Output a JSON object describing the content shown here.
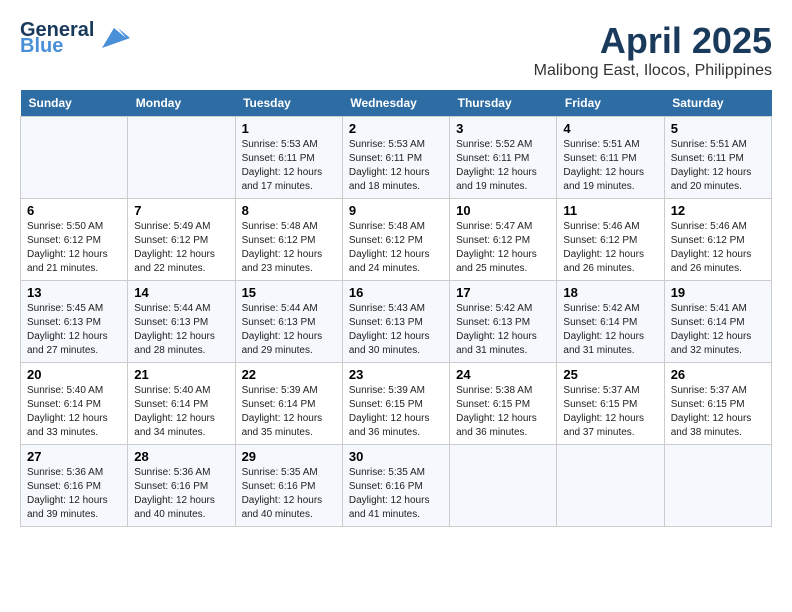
{
  "header": {
    "logo_general": "General",
    "logo_blue": "Blue",
    "title": "April 2025",
    "subtitle": "Malibong East, Ilocos, Philippines"
  },
  "days_of_week": [
    "Sunday",
    "Monday",
    "Tuesday",
    "Wednesday",
    "Thursday",
    "Friday",
    "Saturday"
  ],
  "weeks": [
    [
      {
        "day": "",
        "info": ""
      },
      {
        "day": "",
        "info": ""
      },
      {
        "day": "1",
        "info": "Sunrise: 5:53 AM\nSunset: 6:11 PM\nDaylight: 12 hours and 17 minutes."
      },
      {
        "day": "2",
        "info": "Sunrise: 5:53 AM\nSunset: 6:11 PM\nDaylight: 12 hours and 18 minutes."
      },
      {
        "day": "3",
        "info": "Sunrise: 5:52 AM\nSunset: 6:11 PM\nDaylight: 12 hours and 19 minutes."
      },
      {
        "day": "4",
        "info": "Sunrise: 5:51 AM\nSunset: 6:11 PM\nDaylight: 12 hours and 19 minutes."
      },
      {
        "day": "5",
        "info": "Sunrise: 5:51 AM\nSunset: 6:11 PM\nDaylight: 12 hours and 20 minutes."
      }
    ],
    [
      {
        "day": "6",
        "info": "Sunrise: 5:50 AM\nSunset: 6:12 PM\nDaylight: 12 hours and 21 minutes."
      },
      {
        "day": "7",
        "info": "Sunrise: 5:49 AM\nSunset: 6:12 PM\nDaylight: 12 hours and 22 minutes."
      },
      {
        "day": "8",
        "info": "Sunrise: 5:48 AM\nSunset: 6:12 PM\nDaylight: 12 hours and 23 minutes."
      },
      {
        "day": "9",
        "info": "Sunrise: 5:48 AM\nSunset: 6:12 PM\nDaylight: 12 hours and 24 minutes."
      },
      {
        "day": "10",
        "info": "Sunrise: 5:47 AM\nSunset: 6:12 PM\nDaylight: 12 hours and 25 minutes."
      },
      {
        "day": "11",
        "info": "Sunrise: 5:46 AM\nSunset: 6:12 PM\nDaylight: 12 hours and 26 minutes."
      },
      {
        "day": "12",
        "info": "Sunrise: 5:46 AM\nSunset: 6:12 PM\nDaylight: 12 hours and 26 minutes."
      }
    ],
    [
      {
        "day": "13",
        "info": "Sunrise: 5:45 AM\nSunset: 6:13 PM\nDaylight: 12 hours and 27 minutes."
      },
      {
        "day": "14",
        "info": "Sunrise: 5:44 AM\nSunset: 6:13 PM\nDaylight: 12 hours and 28 minutes."
      },
      {
        "day": "15",
        "info": "Sunrise: 5:44 AM\nSunset: 6:13 PM\nDaylight: 12 hours and 29 minutes."
      },
      {
        "day": "16",
        "info": "Sunrise: 5:43 AM\nSunset: 6:13 PM\nDaylight: 12 hours and 30 minutes."
      },
      {
        "day": "17",
        "info": "Sunrise: 5:42 AM\nSunset: 6:13 PM\nDaylight: 12 hours and 31 minutes."
      },
      {
        "day": "18",
        "info": "Sunrise: 5:42 AM\nSunset: 6:14 PM\nDaylight: 12 hours and 31 minutes."
      },
      {
        "day": "19",
        "info": "Sunrise: 5:41 AM\nSunset: 6:14 PM\nDaylight: 12 hours and 32 minutes."
      }
    ],
    [
      {
        "day": "20",
        "info": "Sunrise: 5:40 AM\nSunset: 6:14 PM\nDaylight: 12 hours and 33 minutes."
      },
      {
        "day": "21",
        "info": "Sunrise: 5:40 AM\nSunset: 6:14 PM\nDaylight: 12 hours and 34 minutes."
      },
      {
        "day": "22",
        "info": "Sunrise: 5:39 AM\nSunset: 6:14 PM\nDaylight: 12 hours and 35 minutes."
      },
      {
        "day": "23",
        "info": "Sunrise: 5:39 AM\nSunset: 6:15 PM\nDaylight: 12 hours and 36 minutes."
      },
      {
        "day": "24",
        "info": "Sunrise: 5:38 AM\nSunset: 6:15 PM\nDaylight: 12 hours and 36 minutes."
      },
      {
        "day": "25",
        "info": "Sunrise: 5:37 AM\nSunset: 6:15 PM\nDaylight: 12 hours and 37 minutes."
      },
      {
        "day": "26",
        "info": "Sunrise: 5:37 AM\nSunset: 6:15 PM\nDaylight: 12 hours and 38 minutes."
      }
    ],
    [
      {
        "day": "27",
        "info": "Sunrise: 5:36 AM\nSunset: 6:16 PM\nDaylight: 12 hours and 39 minutes."
      },
      {
        "day": "28",
        "info": "Sunrise: 5:36 AM\nSunset: 6:16 PM\nDaylight: 12 hours and 40 minutes."
      },
      {
        "day": "29",
        "info": "Sunrise: 5:35 AM\nSunset: 6:16 PM\nDaylight: 12 hours and 40 minutes."
      },
      {
        "day": "30",
        "info": "Sunrise: 5:35 AM\nSunset: 6:16 PM\nDaylight: 12 hours and 41 minutes."
      },
      {
        "day": "",
        "info": ""
      },
      {
        "day": "",
        "info": ""
      },
      {
        "day": "",
        "info": ""
      }
    ]
  ]
}
